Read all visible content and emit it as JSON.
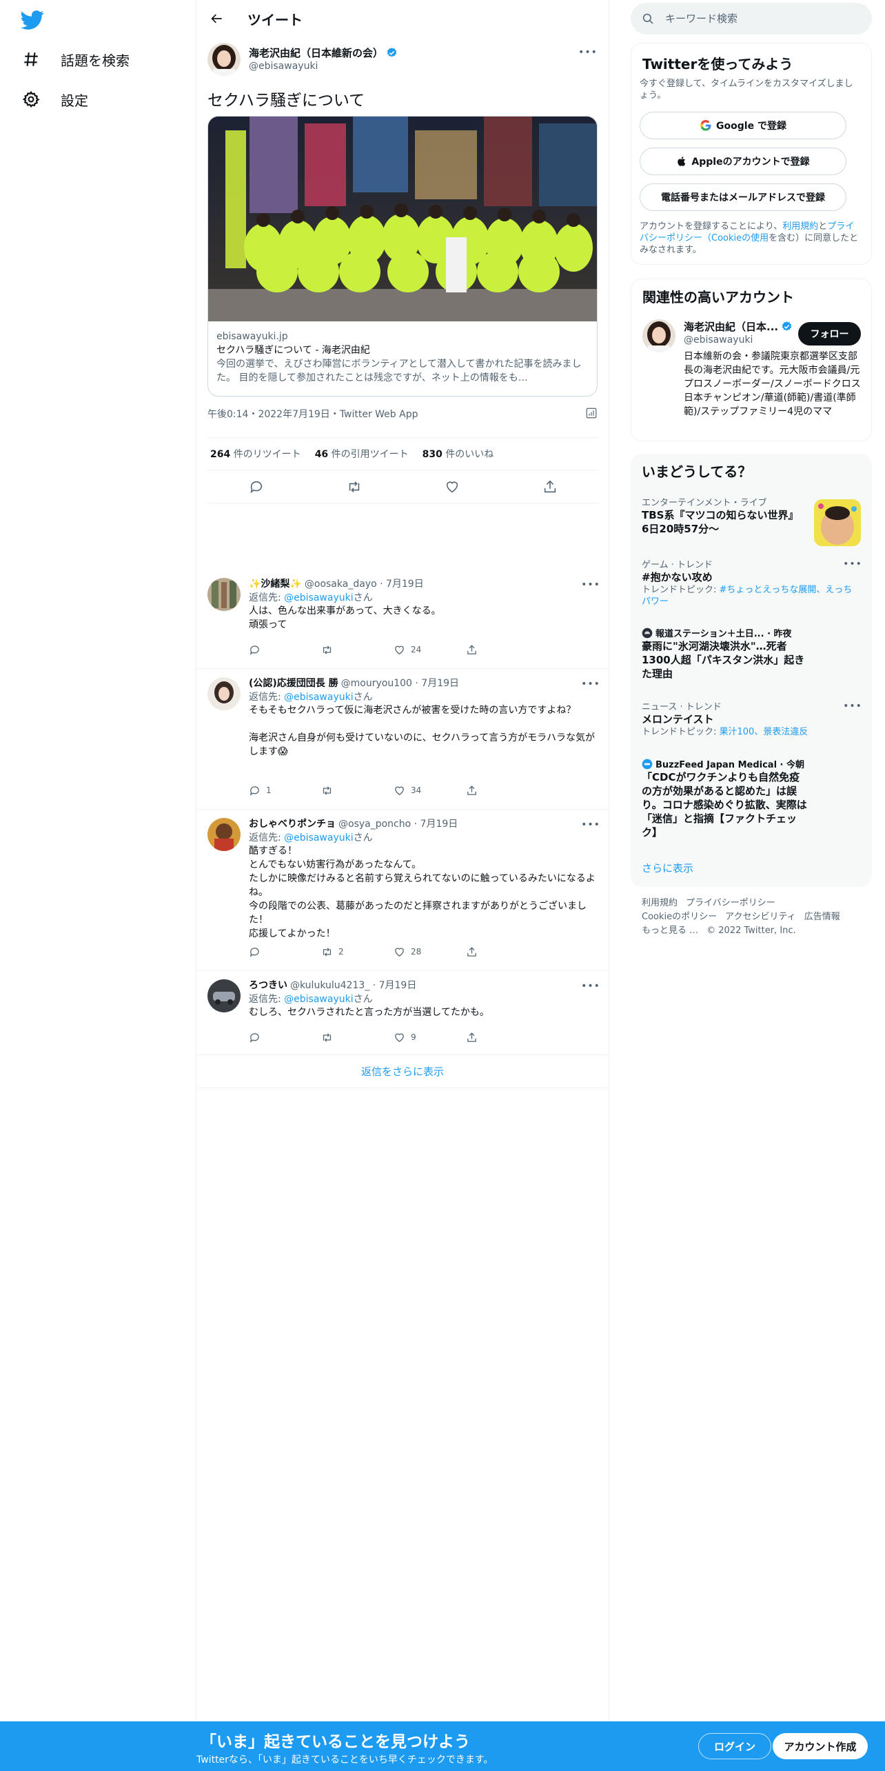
{
  "nav": {
    "explore_label": "話題を検索",
    "settings_label": "設定"
  },
  "header": {
    "title": "ツイート"
  },
  "tweet": {
    "author_name": "海老沢由紀（日本維新の会）",
    "author_handle": "@ebisawayuki",
    "text": "セクハラ騒ぎについて",
    "card": {
      "domain": "ebisawayuki.jp",
      "title": "セクハラ騒ぎについて - 海老沢由紀",
      "description": "今回の選挙で、えびさわ陣営にボランティアとして潜入して書かれた記事を読みました。 目的を隠して参加されたことは残念ですが、ネット上の情報をも…"
    },
    "timestamp": "午後0:14・2022年7月19日・Twitter Web App",
    "stats": {
      "retweets": "264",
      "retweets_label": "件のリツイート",
      "quotes": "46",
      "quotes_label": "件の引用ツイート",
      "likes": "830",
      "likes_label": "件のいいね"
    }
  },
  "replies": [
    {
      "name": "✨沙緒梨✨",
      "handle": "@oosaka_dayo · 7月19日",
      "reply_to_prefix": "返信先: ",
      "reply_to": "@ebisawayuki",
      "reply_to_suffix": "さん",
      "text": "人は、色んな出来事があって、大きくなる。\n頑張って",
      "retweets": "",
      "likes": "24"
    },
    {
      "name": "(公認)応援団団長 勝",
      "handle": "@mouryou100 · 7月19日",
      "reply_to_prefix": "返信先: ",
      "reply_to": "@ebisawayuki",
      "reply_to_suffix": "さん",
      "text": "そもそもセクハラって仮に海老沢さんが被害を受けた時の言い方ですよね？\n\n海老沢さん自身が何も受けていないのに、セクハラって言う方がモラハラな気がします😱",
      "replies": "1",
      "retweets": "",
      "likes": "34"
    },
    {
      "name": "おしゃべりポンチョ",
      "handle": "@osya_poncho · 7月19日",
      "reply_to_prefix": "返信先: ",
      "reply_to": "@ebisawayuki",
      "reply_to_suffix": "さん",
      "text": "酷すぎる！\nとんでもない妨害行為があったなんて。\nたしかに映像だけみると名前すら覚えられてないのに触っているみたいになるよね。\n今の段階での公表、葛藤があったのだと拝察されますがありがとうございました！\n応援してよかった！",
      "retweets": "2",
      "likes": "28"
    },
    {
      "name": "ろつきい",
      "handle": "@kulukulu4213_ · 7月19日",
      "reply_to_prefix": "返信先: ",
      "reply_to": "@ebisawayuki",
      "reply_to_suffix": "さん",
      "text": "むしろ、セクハラされたと言った方が当選してたかも。",
      "retweets": "",
      "likes": "9"
    }
  ],
  "show_more_replies": "返信をさらに表示",
  "search": {
    "placeholder": "キーワード検索"
  },
  "signup_panel": {
    "title": "Twitterを使ってみよう",
    "subtitle": "今すぐ登録して、タイムラインをカスタマイズしましょう。",
    "google_label": "Google で登録",
    "apple_label": "Appleのアカウントで登録",
    "phone_label": "電話番号またはメールアドレスで登録",
    "terms_prefix": "アカウントを登録することにより、",
    "terms_link": "利用規約",
    "terms_and": "と",
    "privacy_link": "プライバシーポリシー（Cookieの使用",
    "terms_suffix": "を含む）に同意したとみなされます。"
  },
  "related": {
    "title": "関連性の高いアカウント",
    "name": "海老沢由紀（日本...",
    "handle": "@ebisawayuki",
    "follow_label": "フォロー",
    "bio": "日本維新の会・参議院東京都選挙区支部長の海老沢由紀です。元大阪市会議員/元プロスノーボーダー/スノーボードクロス日本チャンピオン/華道(師範)/書道(準師範)/ステップファミリー4児のママ"
  },
  "trends": {
    "title": "いまどうしてる？",
    "items": [
      {
        "category": "エンターテインメント・ライブ",
        "title": "TBS系『マツコの知らない世界』6日20時57分〜"
      },
      {
        "category": "ゲーム · トレンド",
        "title": "#抱かない攻め",
        "sub_prefix": "トレンドトピック: ",
        "sub_link": "#ちょっとえっちな展開、えっちパワー"
      },
      {
        "category": "報道ステーション＋土日... · 昨夜",
        "title": "豪雨に\"氷河湖決壊洪水\"…死者1300人超「パキスタン洪水」起きた理由"
      },
      {
        "category": "ニュース · トレンド",
        "title": "メロンテイスト",
        "sub_prefix": "トレンドトピック: ",
        "sub_link": "果汁100、景表法違反"
      },
      {
        "category": "BuzzFeed Japan Medical · 今朝",
        "title": "「CDCがワクチンよりも自然免疫の方が効果があると認めた」は誤り。コロナ感染めぐり拡散、実際は「迷信」と指摘【ファクトチェック】"
      }
    ],
    "show_more": "さらに表示"
  },
  "footer": {
    "terms": "利用規約",
    "privacy": "プライバシーポリシー",
    "cookie": "Cookieのポリシー",
    "accessibility": "アクセシビリティ",
    "ads": "広告情報",
    "more": "もっと見る …",
    "copyright": "© 2022 Twitter, Inc."
  },
  "bottom_bar": {
    "title": "「いま」起きていることを見つけよう",
    "subtitle": "Twitterなら、「いま」起きていることをいち早くチェックできます。",
    "login_label": "ログイン",
    "signup_label": "アカウント作成"
  },
  "colors": {
    "accent": "#1d9bf0",
    "text": "#0f1419",
    "secondary": "#536471",
    "border": "#eff3f4"
  }
}
